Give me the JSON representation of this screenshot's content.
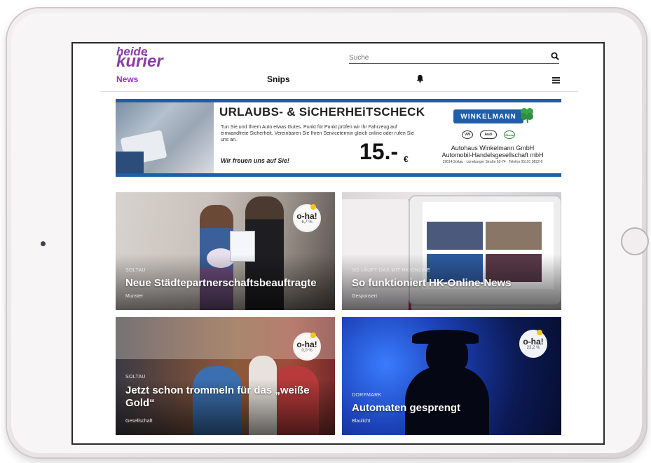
{
  "header": {
    "logo_line1": "heide",
    "logo_line2": "kurier",
    "search_placeholder": "Suche"
  },
  "nav": {
    "news": "News",
    "snips": "Snips",
    "bell_icon": "bell-icon",
    "menu_icon": "hamburger-menu-icon",
    "active_color": "#a030c8"
  },
  "ad": {
    "headline": "URLAUBS- & SiCHERHEiTSCHECK",
    "body": "Tun Sie und Ihrem Auto etwas Gutes. Punkt für Punkt prüfen wir Ihr Fahrzeug auf einwandfreie Sicherheit. Vereinbaren Sie Ihren Servicetermin gleich online oder rufen Sie uns an.",
    "slogan": "Wir freuen uns auf Sie!",
    "price": "15.-",
    "currency": "€",
    "brand": "WINKELMANN",
    "company_line1": "Autohaus Winkelmann GmbH",
    "company_line2": "Automobil-Handelsgesellschaft mbH",
    "address": "29614 Soltau · Lüneburger Straße 62-74 · Telefon 05191 9822-0",
    "car_logos": [
      "VW",
      "Audi",
      "Škoda"
    ]
  },
  "articles": [
    {
      "kicker": "SOLTAU",
      "title": "Neue Städtepartnerschaftsbeauftragte",
      "category": "Munster",
      "oha_label": "o-ha!",
      "oha_pct": "6,7 %"
    },
    {
      "kicker": "SO LÄUFT DAS MIT HK-ONLINE",
      "title": "So funktioniert HK-Online-News",
      "category": "Gesponsert",
      "oha_label": "",
      "oha_pct": ""
    },
    {
      "kicker": "SOLTAU",
      "title": "Jetzt schon trommeln für das „weiße Gold“",
      "category": "Gesellschaft",
      "oha_label": "o-ha!",
      "oha_pct": "0,0 %"
    },
    {
      "kicker": "DORFMARK",
      "title": "Automaten gesprengt",
      "category": "Blaulicht",
      "oha_label": "o-ha!",
      "oha_pct": "23,2 %"
    }
  ]
}
